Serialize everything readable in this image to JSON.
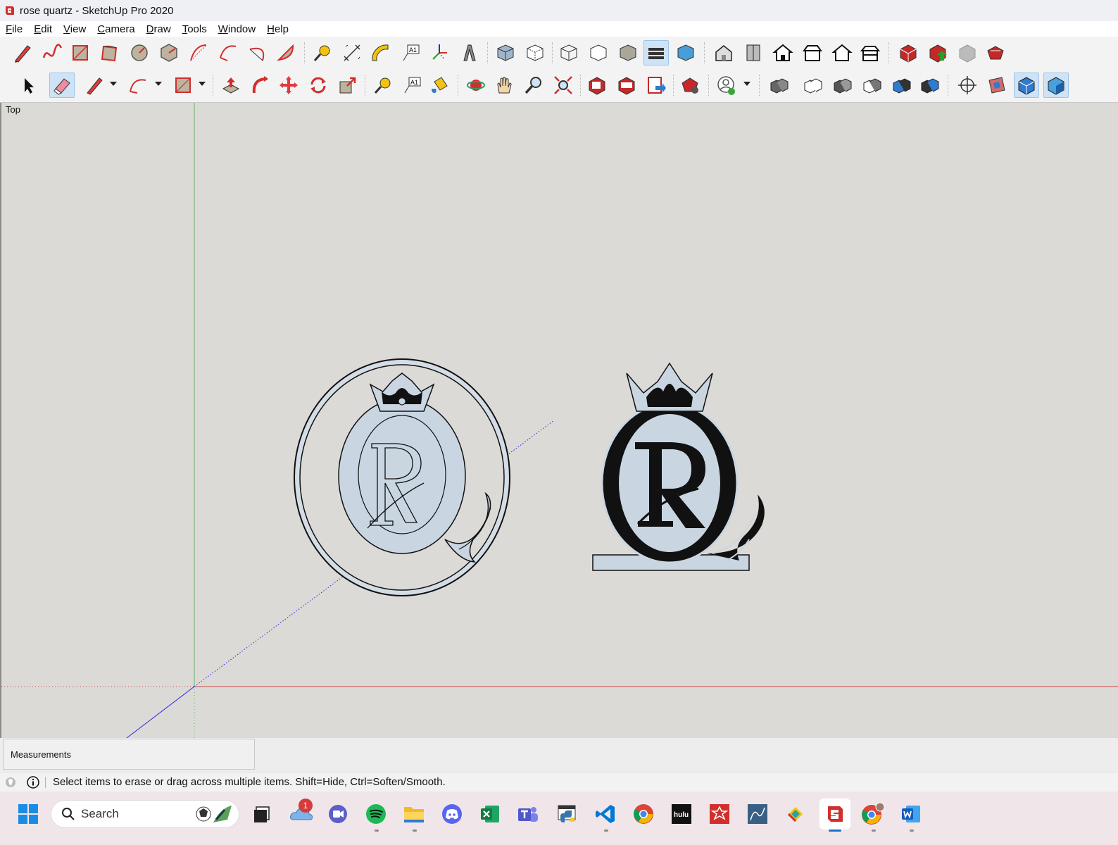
{
  "window": {
    "title": "rose quartz - SketchUp Pro 2020"
  },
  "menu": [
    {
      "accel": "F",
      "rest": "ile"
    },
    {
      "accel": "E",
      "rest": "dit"
    },
    {
      "accel": "V",
      "rest": "iew"
    },
    {
      "accel": "C",
      "rest": "amera"
    },
    {
      "accel": "D",
      "rest": "raw"
    },
    {
      "accel": "T",
      "rest": "ools"
    },
    {
      "accel": "W",
      "rest": "indow"
    },
    {
      "accel": "H",
      "rest": "elp"
    }
  ],
  "toolbar1": {
    "icons": [
      "line-icon",
      "freehand-icon",
      "rectangle-icon",
      "rotated-rectangle-icon",
      "circle-icon",
      "polygon-icon",
      "arc-icon",
      "two-point-arc-icon",
      "three-point-arc-icon",
      "pie-icon",
      "tape-measure-icon",
      "dimension-icon",
      "protractor-icon",
      "text-icon",
      "axes-icon",
      "3d-text-icon",
      "xray-icon",
      "back-edges-icon",
      "wireframe-icon",
      "hidden-line-icon",
      "shaded-icon",
      "shaded-textures-icon",
      "monochrome-icon",
      "iso-view-icon",
      "top-view-icon",
      "front-view-icon",
      "right-view-icon",
      "back-view-icon",
      "left-view-icon",
      "warehouse-icon",
      "share-model-icon",
      "share-component-icon",
      "extension-warehouse-icon"
    ]
  },
  "toolbar2": {
    "icons": [
      "select-icon",
      "eraser-icon",
      "pencil-icon",
      "arc-tool-icon",
      "rectangle-tool-icon",
      "push-pull-icon",
      "follow-me-icon",
      "move-icon",
      "rotate-icon",
      "scale-icon",
      "tape-icon",
      "text-tool-icon",
      "paint-bucket-icon",
      "orbit-icon",
      "pan-icon",
      "zoom-icon",
      "zoom-extents-icon",
      "layout-icon",
      "warehouse-get-icon",
      "send-to-layout-icon",
      "extension-manager-icon",
      "account-icon",
      "outer-shell-icon",
      "union-icon",
      "intersect-icon",
      "subtract-icon",
      "trim-icon",
      "split-icon",
      "section-plane-icon",
      "display-section-planes-icon",
      "display-section-cuts-icon",
      "display-section-fill-icon"
    ]
  },
  "viewport": {
    "view_name": "Top"
  },
  "measurements": {
    "label": "Measurements",
    "value": ""
  },
  "status": {
    "message": "Select items to erase or drag across multiple items. Shift=Hide, Ctrl=Soften/Smooth."
  },
  "taskbar": {
    "search_placeholder": "Search",
    "notification_count": "1",
    "logo_letter": "R",
    "apps": [
      "start-icon",
      "search-box",
      "task-view-icon",
      "onedrive-icon",
      "meet-icon",
      "spotify-icon",
      "file-explorer-icon",
      "discord-icon",
      "excel-icon",
      "teams-icon",
      "python-icon",
      "vscode-icon",
      "chrome-icon",
      "hulu-icon",
      "wolfram-icon",
      "ssms-icon",
      "git-icon",
      "sketchup-icon",
      "chrome-profile-icon",
      "word-icon"
    ],
    "hulu_label": "hulu"
  },
  "colors": {
    "viewport_bg": "#dcdad6",
    "logo_fill": "#c9d6e2",
    "accent_blue": "#1a6fd0",
    "sketchup_red": "#d12e2e"
  }
}
